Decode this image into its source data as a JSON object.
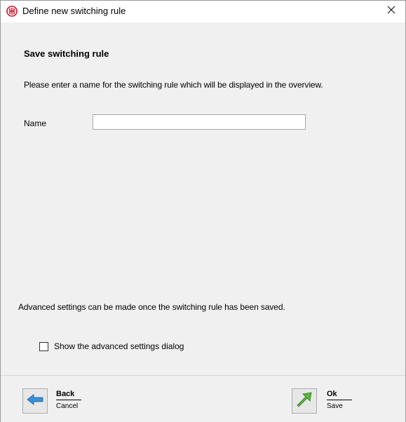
{
  "window": {
    "title": "Define new switching rule"
  },
  "page": {
    "heading": "Save switching rule",
    "intro": "Please enter a name for the switching rule which will be displayed in the overview.",
    "name_label": "Name",
    "name_value": "",
    "name_placeholder": "",
    "advanced_note": "Advanced settings can be made once the switching rule has been saved.",
    "advanced_checkbox_label": "Show the advanced settings dialog",
    "advanced_checkbox_checked": false
  },
  "footer": {
    "back_label": "Back",
    "back_sub": "Cancel",
    "ok_label": "Ok",
    "ok_sub": "Save"
  },
  "colors": {
    "app_icon_red": "#d0142a",
    "back_arrow_blue": "#3a8fd8",
    "ok_arrow_green": "#5bb43c"
  }
}
